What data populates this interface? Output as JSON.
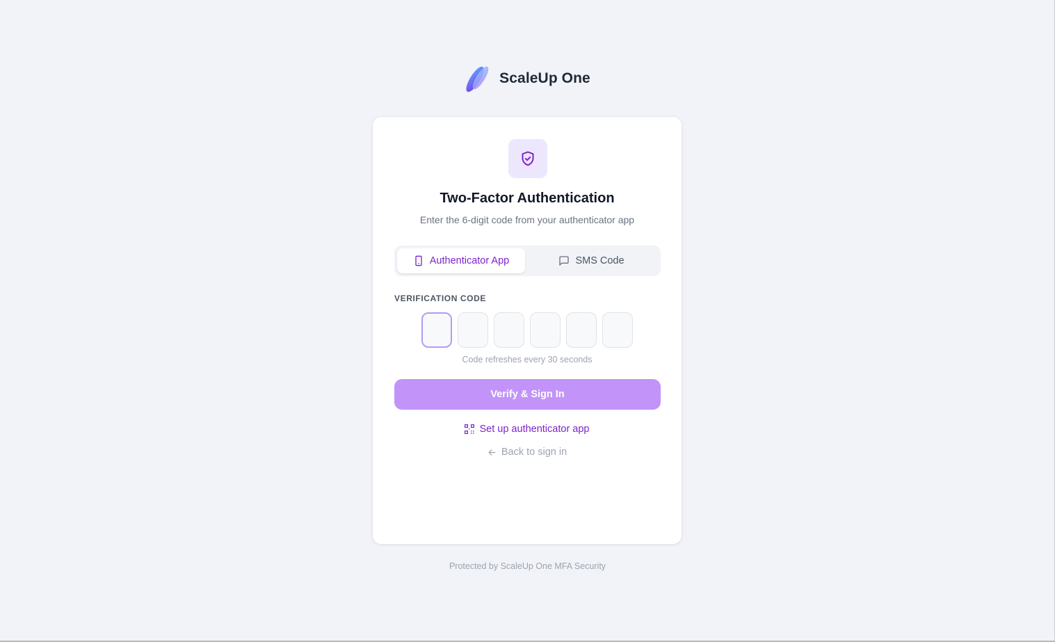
{
  "brand": {
    "name": "ScaleUp One",
    "logo_icon": "brand-logo-icon",
    "logo_colors": [
      "#7c3aed",
      "#60a5fa"
    ]
  },
  "card": {
    "icon": "shield-check-icon",
    "title": "Two-Factor Authentication",
    "subtitle": "Enter the 6-digit code from your authenticator app"
  },
  "tabs": [
    {
      "label": "Authenticator App",
      "icon": "smartphone-icon",
      "active": true
    },
    {
      "label": "SMS Code",
      "icon": "message-square-icon",
      "active": false
    }
  ],
  "verification": {
    "label": "VERIFICATION CODE",
    "digits": [
      "",
      "",
      "",
      "",
      "",
      ""
    ],
    "focused_index": 0,
    "hint": "Code refreshes every 30 seconds"
  },
  "actions": {
    "verify_label": "Verify & Sign In",
    "setup_label": "Set up authenticator app",
    "setup_icon": "qr-code-icon",
    "back_label": "Back to sign in",
    "back_icon": "arrow-left-icon"
  },
  "footer": {
    "text": "Protected by ScaleUp One MFA Security"
  },
  "colors": {
    "accent": "#7e22ce",
    "button_disabled": "#c293f8",
    "page_background": "#f1f3f8",
    "icon_badge": "#ede7fd"
  }
}
